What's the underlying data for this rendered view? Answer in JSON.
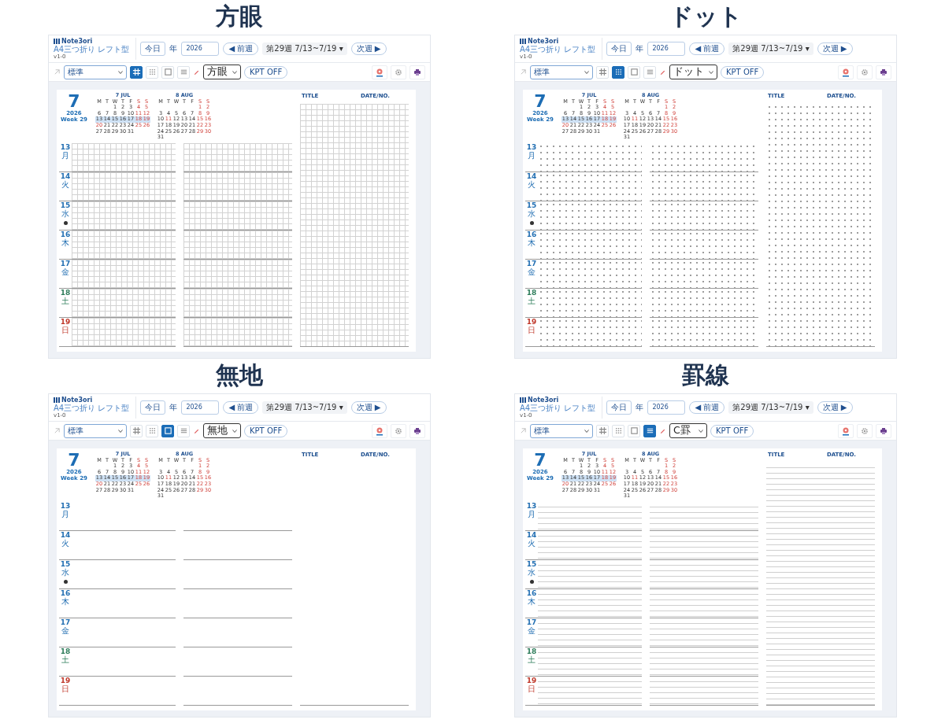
{
  "panels": [
    {
      "heading": "方眼",
      "kind": "grid",
      "app": {
        "logo": "Note3ori",
        "subtitle": "A4三つ折り レフト型",
        "version": "v1-0",
        "today": "今日",
        "year_label": "年",
        "year": "2026",
        "prev": "◀ 前週",
        "week": "第29週 7/13~7/19 ▾",
        "next": "次週 ▶",
        "layout": "標準",
        "pattern_buttons": [
          {
            "kind": "grid",
            "selected": true
          },
          {
            "kind": "dot",
            "selected": false
          },
          {
            "kind": "plain",
            "selected": false
          },
          {
            "kind": "lined",
            "selected": false
          }
        ],
        "pattern_select": "方眼",
        "kpt": "KPT OFF"
      },
      "page": {
        "month": "7",
        "year": "2026",
        "week": "Week 29",
        "title_label": "TITLE",
        "date_label": "DATE/NO.",
        "calendars": [
          {
            "title": "7 JUL",
            "weekdays": [
              "M",
              "T",
              "W",
              "T",
              "F",
              "S",
              "S"
            ],
            "weeks": [
              {
                "current": false,
                "days": [
                  "1",
                  "2",
                  "3",
                  "4",
                  "5"
                ]
              },
              {
                "current": false,
                "days": [
                  "6",
                  "7",
                  "8",
                  "9",
                  "10",
                  "11",
                  "12"
                ]
              },
              {
                "current": true,
                "days": [
                  "13",
                  "14",
                  "15",
                  "16",
                  "17",
                  "18",
                  "19"
                ]
              },
              {
                "current": false,
                "days": [
                  {
                    "day": "20",
                    "holiday": true
                  },
                  "21",
                  "22",
                  "23",
                  "24",
                  "25",
                  "26"
                ]
              },
              {
                "current": false,
                "days": [
                  "27",
                  "28",
                  "29",
                  "30",
                  "31"
                ]
              }
            ]
          },
          {
            "title": "8 AUG",
            "weekdays": [
              "M",
              "T",
              "W",
              "T",
              "F",
              "S",
              "S"
            ],
            "weeks": [
              {
                "current": false,
                "days": [
                  "1",
                  "2"
                ]
              },
              {
                "current": false,
                "days": [
                  "3",
                  "4",
                  "5",
                  "6",
                  "7",
                  "8",
                  "9"
                ]
              },
              {
                "current": false,
                "days": [
                  "10",
                  {
                    "day": "11",
                    "holiday": true
                  },
                  "12",
                  "13",
                  "14",
                  "15",
                  "16"
                ]
              },
              {
                "current": false,
                "days": [
                  "17",
                  "18",
                  "19",
                  "20",
                  "21",
                  "22",
                  "23"
                ]
              },
              {
                "current": false,
                "days": [
                  "24",
                  "25",
                  "26",
                  "27",
                  "28",
                  "29",
                  "30"
                ]
              },
              {
                "current": false,
                "days": [
                  "31"
                ]
              }
            ]
          }
        ],
        "days": [
          {
            "day": "13",
            "weekday": "月",
            "color": "#2470b3",
            "moon": false
          },
          {
            "day": "14",
            "weekday": "火",
            "color": "#2470b3",
            "moon": false
          },
          {
            "day": "15",
            "weekday": "水",
            "color": "#2470b3",
            "moon": true
          },
          {
            "day": "16",
            "weekday": "木",
            "color": "#2470b3",
            "moon": false
          },
          {
            "day": "17",
            "weekday": "金",
            "color": "#2470b3",
            "moon": false
          },
          {
            "day": "18",
            "weekday": "土",
            "color": "#2e7d5b",
            "moon": false
          },
          {
            "day": "19",
            "weekday": "日",
            "color": "#c0392b",
            "moon": false
          }
        ]
      }
    },
    {
      "heading": "ドット",
      "kind": "dot",
      "app": {
        "logo": "Note3ori",
        "subtitle": "A4三つ折り レフト型",
        "version": "v1-0",
        "today": "今日",
        "year_label": "年",
        "year": "2026",
        "prev": "◀ 前週",
        "week": "第29週 7/13~7/19 ▾",
        "next": "次週 ▶",
        "layout": "標準",
        "pattern_buttons": [
          {
            "kind": "grid",
            "selected": false
          },
          {
            "kind": "dot",
            "selected": true
          },
          {
            "kind": "plain",
            "selected": false
          },
          {
            "kind": "lined",
            "selected": false
          }
        ],
        "pattern_select": "ドット",
        "kpt": "KPT OFF"
      },
      "page": {
        "month": "7",
        "year": "2026",
        "week": "Week 29",
        "title_label": "TITLE",
        "date_label": "DATE/NO.",
        "calendars": [
          {
            "title": "7 JUL",
            "weekdays": [
              "M",
              "T",
              "W",
              "T",
              "F",
              "S",
              "S"
            ],
            "weeks": [
              {
                "current": false,
                "days": [
                  "1",
                  "2",
                  "3",
                  "4",
                  "5"
                ]
              },
              {
                "current": false,
                "days": [
                  "6",
                  "7",
                  "8",
                  "9",
                  "10",
                  "11",
                  "12"
                ]
              },
              {
                "current": true,
                "days": [
                  "13",
                  "14",
                  "15",
                  "16",
                  "17",
                  "18",
                  "19"
                ]
              },
              {
                "current": false,
                "days": [
                  {
                    "day": "20",
                    "holiday": true
                  },
                  "21",
                  "22",
                  "23",
                  "24",
                  "25",
                  "26"
                ]
              },
              {
                "current": false,
                "days": [
                  "27",
                  "28",
                  "29",
                  "30",
                  "31"
                ]
              }
            ]
          },
          {
            "title": "8 AUG",
            "weekdays": [
              "M",
              "T",
              "W",
              "T",
              "F",
              "S",
              "S"
            ],
            "weeks": [
              {
                "current": false,
                "days": [
                  "1",
                  "2"
                ]
              },
              {
                "current": false,
                "days": [
                  "3",
                  "4",
                  "5",
                  "6",
                  "7",
                  "8",
                  "9"
                ]
              },
              {
                "current": false,
                "days": [
                  "10",
                  {
                    "day": "11",
                    "holiday": true
                  },
                  "12",
                  "13",
                  "14",
                  "15",
                  "16"
                ]
              },
              {
                "current": false,
                "days": [
                  "17",
                  "18",
                  "19",
                  "20",
                  "21",
                  "22",
                  "23"
                ]
              },
              {
                "current": false,
                "days": [
                  "24",
                  "25",
                  "26",
                  "27",
                  "28",
                  "29",
                  "30"
                ]
              },
              {
                "current": false,
                "days": [
                  "31"
                ]
              }
            ]
          }
        ],
        "days": [
          {
            "day": "13",
            "weekday": "月",
            "color": "#2470b3",
            "moon": false
          },
          {
            "day": "14",
            "weekday": "火",
            "color": "#2470b3",
            "moon": false
          },
          {
            "day": "15",
            "weekday": "水",
            "color": "#2470b3",
            "moon": true
          },
          {
            "day": "16",
            "weekday": "木",
            "color": "#2470b3",
            "moon": false
          },
          {
            "day": "17",
            "weekday": "金",
            "color": "#2470b3",
            "moon": false
          },
          {
            "day": "18",
            "weekday": "土",
            "color": "#2e7d5b",
            "moon": false
          },
          {
            "day": "19",
            "weekday": "日",
            "color": "#c0392b",
            "moon": false
          }
        ]
      }
    },
    {
      "heading": "無地",
      "kind": "plain",
      "app": {
        "logo": "Note3ori",
        "subtitle": "A4三つ折り レフト型",
        "version": "v1-0",
        "today": "今日",
        "year_label": "年",
        "year": "2026",
        "prev": "◀ 前週",
        "week": "第29週 7/13~7/19 ▾",
        "next": "次週 ▶",
        "layout": "標準",
        "pattern_buttons": [
          {
            "kind": "grid",
            "selected": false
          },
          {
            "kind": "dot",
            "selected": false
          },
          {
            "kind": "plain",
            "selected": true
          },
          {
            "kind": "lined",
            "selected": false
          }
        ],
        "pattern_select": "無地",
        "kpt": "KPT OFF"
      },
      "page": {
        "month": "7",
        "year": "2026",
        "week": "Week 29",
        "title_label": "TITLE",
        "date_label": "DATE/NO.",
        "calendars": [
          {
            "title": "7 JUL",
            "weekdays": [
              "M",
              "T",
              "W",
              "T",
              "F",
              "S",
              "S"
            ],
            "weeks": [
              {
                "current": false,
                "days": [
                  "1",
                  "2",
                  "3",
                  "4",
                  "5"
                ]
              },
              {
                "current": false,
                "days": [
                  "6",
                  "7",
                  "8",
                  "9",
                  "10",
                  "11",
                  "12"
                ]
              },
              {
                "current": true,
                "days": [
                  "13",
                  "14",
                  "15",
                  "16",
                  "17",
                  "18",
                  "19"
                ]
              },
              {
                "current": false,
                "days": [
                  {
                    "day": "20",
                    "holiday": true
                  },
                  "21",
                  "22",
                  "23",
                  "24",
                  "25",
                  "26"
                ]
              },
              {
                "current": false,
                "days": [
                  "27",
                  "28",
                  "29",
                  "30",
                  "31"
                ]
              }
            ]
          },
          {
            "title": "8 AUG",
            "weekdays": [
              "M",
              "T",
              "W",
              "T",
              "F",
              "S",
              "S"
            ],
            "weeks": [
              {
                "current": false,
                "days": [
                  "1",
                  "2"
                ]
              },
              {
                "current": false,
                "days": [
                  "3",
                  "4",
                  "5",
                  "6",
                  "7",
                  "8",
                  "9"
                ]
              },
              {
                "current": false,
                "days": [
                  "10",
                  {
                    "day": "11",
                    "holiday": true
                  },
                  "12",
                  "13",
                  "14",
                  "15",
                  "16"
                ]
              },
              {
                "current": false,
                "days": [
                  "17",
                  "18",
                  "19",
                  "20",
                  "21",
                  "22",
                  "23"
                ]
              },
              {
                "current": false,
                "days": [
                  "24",
                  "25",
                  "26",
                  "27",
                  "28",
                  "29",
                  "30"
                ]
              },
              {
                "current": false,
                "days": [
                  "31"
                ]
              }
            ]
          }
        ],
        "days": [
          {
            "day": "13",
            "weekday": "月",
            "color": "#2470b3",
            "moon": false
          },
          {
            "day": "14",
            "weekday": "火",
            "color": "#2470b3",
            "moon": false
          },
          {
            "day": "15",
            "weekday": "水",
            "color": "#2470b3",
            "moon": true
          },
          {
            "day": "16",
            "weekday": "木",
            "color": "#2470b3",
            "moon": false
          },
          {
            "day": "17",
            "weekday": "金",
            "color": "#2470b3",
            "moon": false
          },
          {
            "day": "18",
            "weekday": "土",
            "color": "#2e7d5b",
            "moon": false
          },
          {
            "day": "19",
            "weekday": "日",
            "color": "#c0392b",
            "moon": false
          }
        ]
      }
    },
    {
      "heading": "罫線",
      "kind": "lined",
      "app": {
        "logo": "Note3ori",
        "subtitle": "A4三つ折り レフト型",
        "version": "v1-0",
        "today": "今日",
        "year_label": "年",
        "year": "2026",
        "prev": "◀ 前週",
        "week": "第29週 7/13~7/19 ▾",
        "next": "次週 ▶",
        "layout": "標準",
        "pattern_buttons": [
          {
            "kind": "grid",
            "selected": false
          },
          {
            "kind": "dot",
            "selected": false
          },
          {
            "kind": "plain",
            "selected": false
          },
          {
            "kind": "lined",
            "selected": true
          }
        ],
        "pattern_select": "C罫",
        "kpt": "KPT OFF"
      },
      "page": {
        "month": "7",
        "year": "2026",
        "week": "Week 29",
        "title_label": "TITLE",
        "date_label": "DATE/NO.",
        "calendars": [
          {
            "title": "7 JUL",
            "weekdays": [
              "M",
              "T",
              "W",
              "T",
              "F",
              "S",
              "S"
            ],
            "weeks": [
              {
                "current": false,
                "days": [
                  "1",
                  "2",
                  "3",
                  "4",
                  "5"
                ]
              },
              {
                "current": false,
                "days": [
                  "6",
                  "7",
                  "8",
                  "9",
                  "10",
                  "11",
                  "12"
                ]
              },
              {
                "current": true,
                "days": [
                  "13",
                  "14",
                  "15",
                  "16",
                  "17",
                  "18",
                  "19"
                ]
              },
              {
                "current": false,
                "days": [
                  {
                    "day": "20",
                    "holiday": true
                  },
                  "21",
                  "22",
                  "23",
                  "24",
                  "25",
                  "26"
                ]
              },
              {
                "current": false,
                "days": [
                  "27",
                  "28",
                  "29",
                  "30",
                  "31"
                ]
              }
            ]
          },
          {
            "title": "8 AUG",
            "weekdays": [
              "M",
              "T",
              "W",
              "T",
              "F",
              "S",
              "S"
            ],
            "weeks": [
              {
                "current": false,
                "days": [
                  "1",
                  "2"
                ]
              },
              {
                "current": false,
                "days": [
                  "3",
                  "4",
                  "5",
                  "6",
                  "7",
                  "8",
                  "9"
                ]
              },
              {
                "current": false,
                "days": [
                  "10",
                  {
                    "day": "11",
                    "holiday": true
                  },
                  "12",
                  "13",
                  "14",
                  "15",
                  "16"
                ]
              },
              {
                "current": false,
                "days": [
                  "17",
                  "18",
                  "19",
                  "20",
                  "21",
                  "22",
                  "23"
                ]
              },
              {
                "current": false,
                "days": [
                  "24",
                  "25",
                  "26",
                  "27",
                  "28",
                  "29",
                  "30"
                ]
              },
              {
                "current": false,
                "days": [
                  "31"
                ]
              }
            ]
          }
        ],
        "days": [
          {
            "day": "13",
            "weekday": "月",
            "color": "#2470b3",
            "moon": false
          },
          {
            "day": "14",
            "weekday": "火",
            "color": "#2470b3",
            "moon": false
          },
          {
            "day": "15",
            "weekday": "水",
            "color": "#2470b3",
            "moon": true
          },
          {
            "day": "16",
            "weekday": "木",
            "color": "#2470b3",
            "moon": false
          },
          {
            "day": "17",
            "weekday": "金",
            "color": "#2470b3",
            "moon": false
          },
          {
            "day": "18",
            "weekday": "土",
            "color": "#2e7d5b",
            "moon": false
          },
          {
            "day": "19",
            "weekday": "日",
            "color": "#c0392b",
            "moon": false
          }
        ]
      }
    }
  ]
}
